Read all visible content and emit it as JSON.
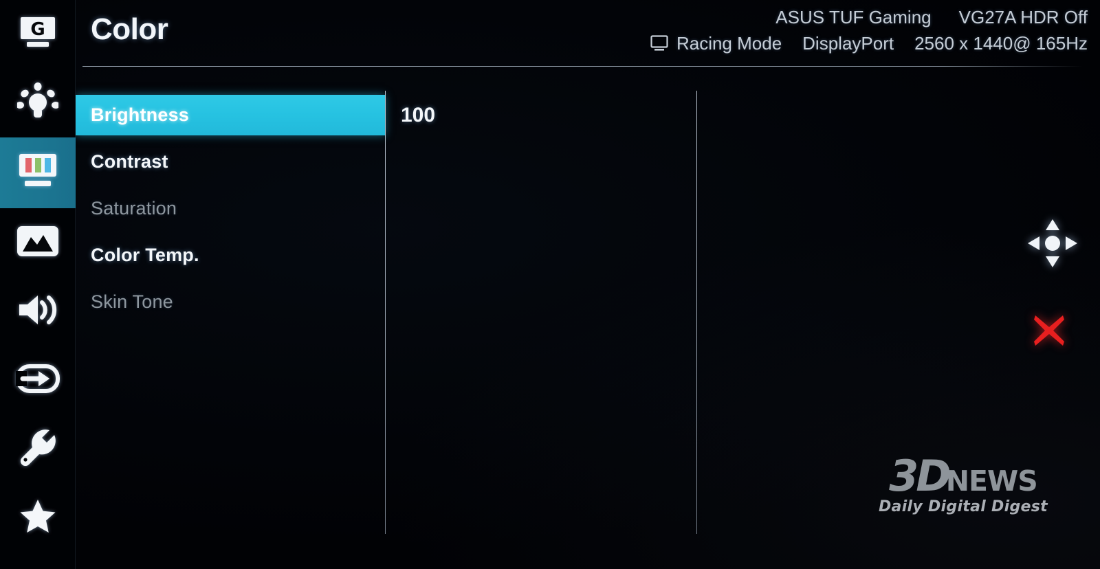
{
  "osd": {
    "page_title": "Color",
    "accent_color": "#26c2e1",
    "rail_active_color": "#1b7490",
    "close_color": "#e81f1f"
  },
  "header": {
    "title": "Color",
    "brand": "ASUS TUF Gaming",
    "model_hdr": "VG27A HDR Off",
    "preset_mode": "Racing Mode",
    "input_source": "DisplayPort",
    "resolution": "2560 x 1440@ 165Hz",
    "mode_icon": "monitor-icon"
  },
  "sidebar": {
    "items": [
      {
        "id": "gamevisual",
        "label": "GameVisual",
        "icon": "gamevisual-monitor-g-icon",
        "active": false
      },
      {
        "id": "blue-light-filter",
        "label": "Blue Light Filter",
        "icon": "lightbulb-icon",
        "active": false
      },
      {
        "id": "color",
        "label": "Color",
        "icon": "color-bars-monitor-icon",
        "active": true
      },
      {
        "id": "image",
        "label": "Image",
        "icon": "picture-icon",
        "active": false
      },
      {
        "id": "sound",
        "label": "Sound",
        "icon": "speaker-icon",
        "active": false
      },
      {
        "id": "input-select",
        "label": "Input Select",
        "icon": "input-arrow-icon",
        "active": false
      },
      {
        "id": "system-setup",
        "label": "System Setup",
        "icon": "wrench-icon",
        "active": false
      },
      {
        "id": "myfavorite",
        "label": "MyFavorite",
        "icon": "star-icon",
        "active": false
      }
    ]
  },
  "menu": {
    "items": [
      {
        "label": "Brightness",
        "state": "selected",
        "value": "100"
      },
      {
        "label": "Contrast",
        "state": "normal",
        "value": ""
      },
      {
        "label": "Saturation",
        "state": "disabled",
        "value": ""
      },
      {
        "label": "Color Temp.",
        "state": "normal",
        "value": ""
      },
      {
        "label": "Skin Tone",
        "state": "disabled",
        "value": ""
      }
    ],
    "selected_value": "100"
  },
  "controls": {
    "nav_pad": "four-way-navigation-icon",
    "close": "close-x-icon"
  },
  "watermark": {
    "logo_3d": "3D",
    "logo_news": "NEWS",
    "tagline": "Daily Digital Digest"
  }
}
